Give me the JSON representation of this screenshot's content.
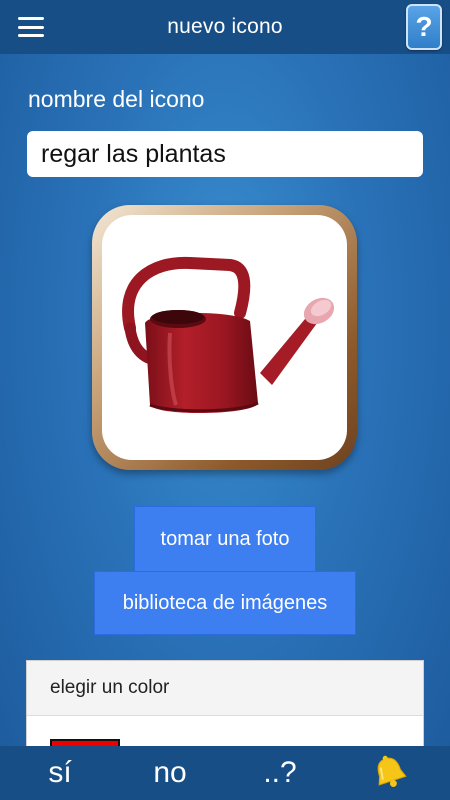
{
  "appbar": {
    "title": "nuevo icono",
    "menu_icon": "hamburger-menu-icon",
    "help_label": "?"
  },
  "form": {
    "name_label": "nombre del icono",
    "name_value": "regar las plantas"
  },
  "icon_preview": {
    "image": "red-watering-can"
  },
  "actions": {
    "photo_label": "tomar una foto",
    "library_label": "biblioteca de imágenes"
  },
  "color_panel": {
    "header": "elegir un color",
    "selected_color": "#ee0000"
  },
  "bottom_bar": {
    "yes_label": "sí",
    "no_label": "no",
    "more_label": "..?",
    "bell_icon": "bell-icon"
  },
  "colors": {
    "appbar_bg": "#184e86",
    "button_bg": "#3d7ef0",
    "bell": "#f5c518"
  }
}
